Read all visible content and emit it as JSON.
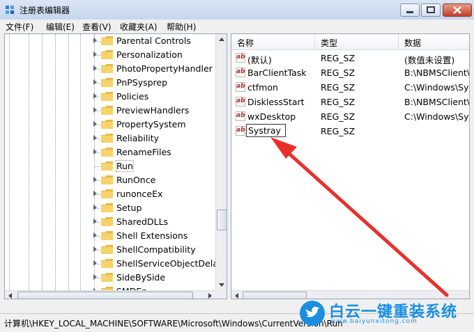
{
  "window": {
    "title": "注册表编辑器",
    "controls": {
      "minimize": "minimize-icon",
      "maximize": "maximize-icon",
      "close": "close-icon"
    }
  },
  "menu": {
    "items": [
      "文件(F)",
      "编辑(E)",
      "查看(V)",
      "收藏夹(A)",
      "帮助(H)"
    ]
  },
  "tree": {
    "items": [
      {
        "label": "Parental Controls"
      },
      {
        "label": "Personalization"
      },
      {
        "label": "PhotoPropertyHandler"
      },
      {
        "label": "PnPSysprep"
      },
      {
        "label": "Policies"
      },
      {
        "label": "PreviewHandlers"
      },
      {
        "label": "PropertySystem"
      },
      {
        "label": "Reliability"
      },
      {
        "label": "RenameFiles"
      },
      {
        "label": "Run",
        "selected": true
      },
      {
        "label": "RunOnce"
      },
      {
        "label": "runonceEx"
      },
      {
        "label": "Setup"
      },
      {
        "label": "SharedDLLs"
      },
      {
        "label": "Shell Extensions"
      },
      {
        "label": "ShellCompatibility"
      },
      {
        "label": "ShellServiceObjectDelayL"
      },
      {
        "label": "SideBySide"
      },
      {
        "label": "SMDEn"
      }
    ]
  },
  "list": {
    "columns": [
      "名称",
      "类型",
      "数据"
    ],
    "rows": [
      {
        "name": "(默认)",
        "type": "REG_SZ",
        "data": "(数值未设置)"
      },
      {
        "name": "BarClientTask",
        "type": "REG_SZ",
        "data": "B:\\NBMSClient\\"
      },
      {
        "name": "ctfmon",
        "type": "REG_SZ",
        "data": "C:\\Windows\\Sys"
      },
      {
        "name": "DisklessStart",
        "type": "REG_SZ",
        "data": "B:\\NBMSClient\\"
      },
      {
        "name": "wxDesktop",
        "type": "REG_SZ",
        "data": "C:\\Windows\\Sys"
      },
      {
        "name": "Systray",
        "type": "REG_SZ",
        "data": "",
        "renaming": true
      }
    ]
  },
  "status": {
    "path": "计算机\\HKEY_LOCAL_MACHINE\\SOFTWARE\\Microsoft\\Windows\\CurrentVersion\\Run"
  },
  "annotation": {
    "color": "#e8302c"
  },
  "watermark": {
    "brand": "白云一键重装系统",
    "url": "www.baiyunxitong.com",
    "color": "#1a8fe0"
  }
}
